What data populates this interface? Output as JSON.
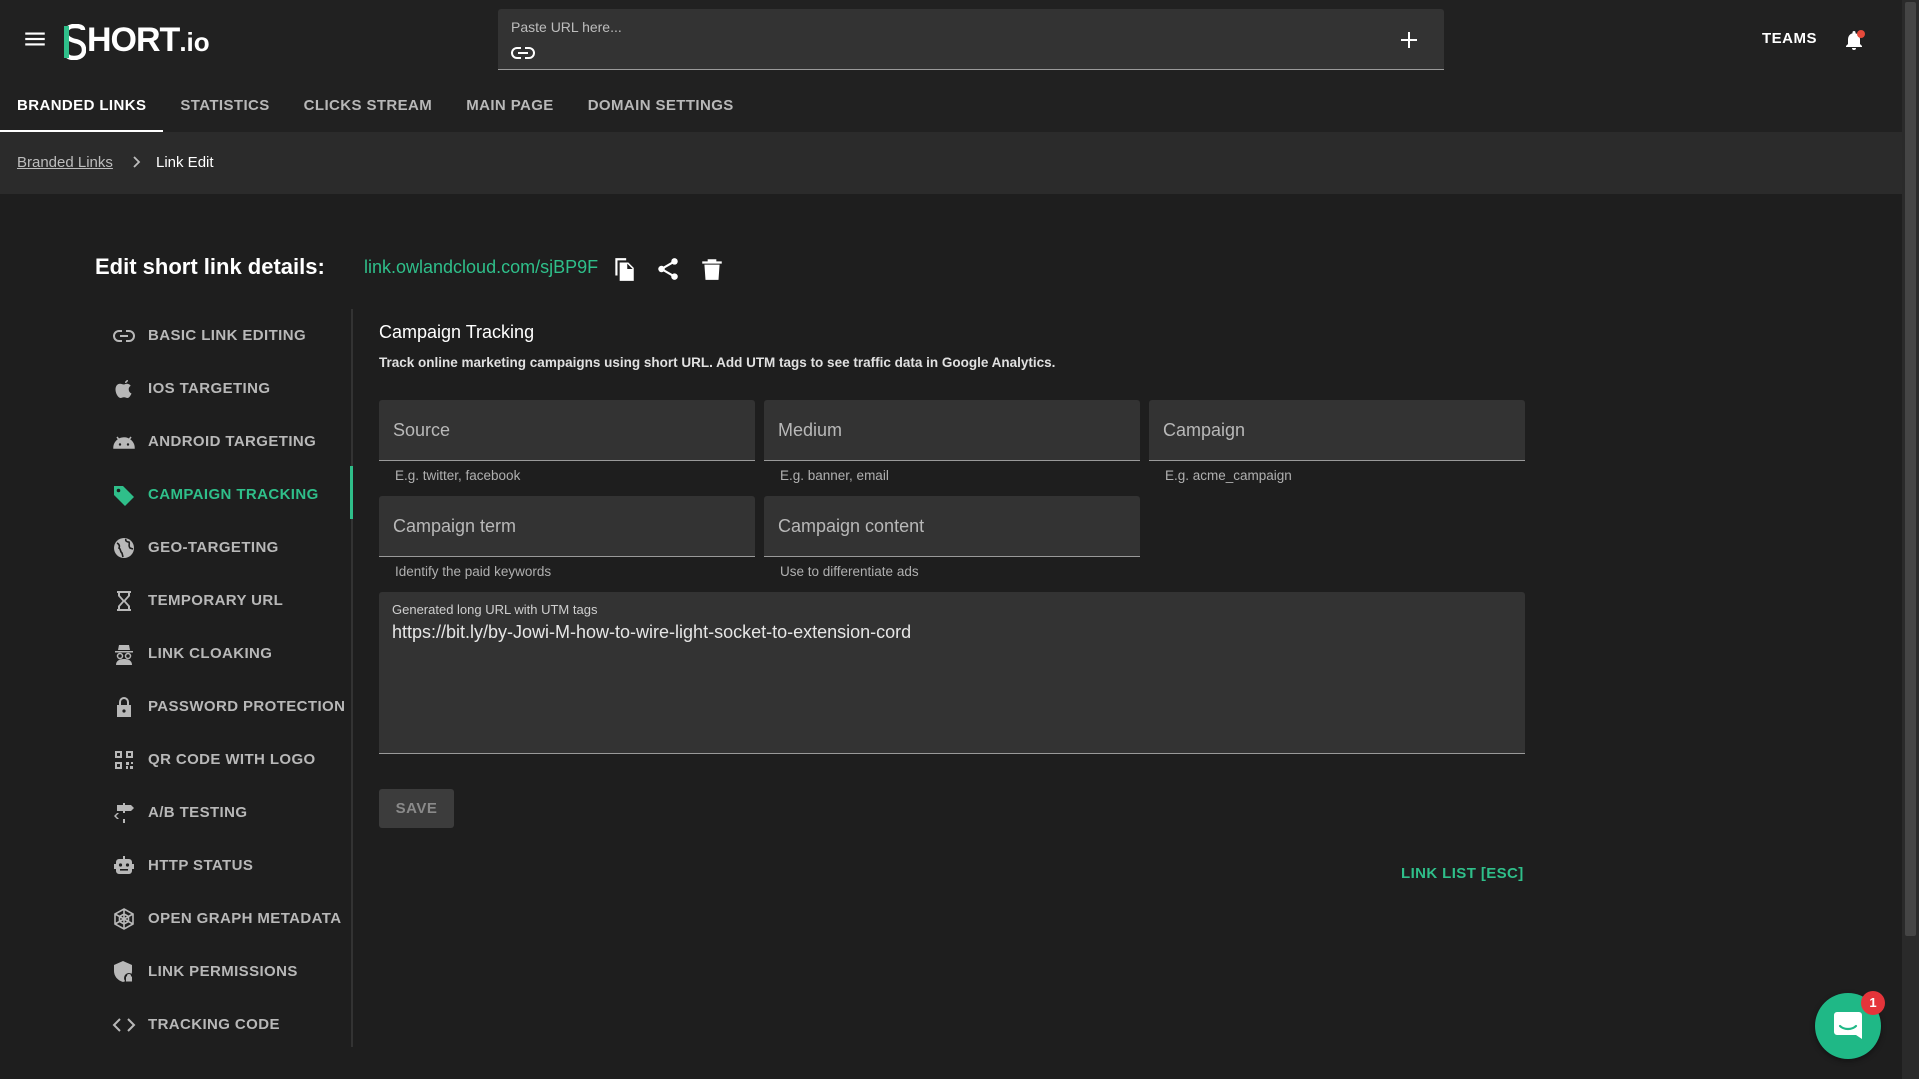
{
  "header": {
    "logo_main": "HORT",
    "logo_suffix": ".io",
    "url_placeholder": "Paste URL here...",
    "teams_label": "TEAMS"
  },
  "tabs": [
    {
      "label": "BRANDED LINKS",
      "active": true
    },
    {
      "label": "STATISTICS"
    },
    {
      "label": "CLICKS STREAM"
    },
    {
      "label": "MAIN PAGE"
    },
    {
      "label": "DOMAIN SETTINGS"
    }
  ],
  "breadcrumb": {
    "parent": "Branded Links",
    "current": "Link Edit"
  },
  "editor": {
    "title": "Edit short link details:",
    "short_link": "link.owlandcloud.com/sjBP9F"
  },
  "nav": [
    {
      "label": "BASIC LINK EDITING",
      "icon": "link-icon"
    },
    {
      "label": "IOS TARGETING",
      "icon": "apple-icon"
    },
    {
      "label": "ANDROID TARGETING",
      "icon": "android-icon"
    },
    {
      "label": "CAMPAIGN TRACKING",
      "icon": "tag-icon",
      "active": true
    },
    {
      "label": "GEO-TARGETING",
      "icon": "globe-icon"
    },
    {
      "label": "TEMPORARY URL",
      "icon": "hourglass-icon"
    },
    {
      "label": "LINK CLOAKING",
      "icon": "spy-icon"
    },
    {
      "label": "PASSWORD PROTECTION",
      "icon": "lock-icon"
    },
    {
      "label": "QR CODE WITH LOGO",
      "icon": "qr-code-icon"
    },
    {
      "label": "A/B TESTING",
      "icon": "signpost-icon"
    },
    {
      "label": "HTTP STATUS",
      "icon": "robot-icon"
    },
    {
      "label": "OPEN GRAPH METADATA",
      "icon": "graph-network-icon"
    },
    {
      "label": "LINK PERMISSIONS",
      "icon": "shield-lock-icon"
    },
    {
      "label": "TRACKING CODE",
      "icon": "code-icon"
    }
  ],
  "campaign": {
    "title": "Campaign Tracking",
    "description": "Track online marketing campaigns using short URL. Add UTM tags to see traffic data in Google Analytics.",
    "source": {
      "placeholder": "Source",
      "helper": "E.g. twitter, facebook",
      "value": ""
    },
    "medium": {
      "placeholder": "Medium",
      "helper": "E.g. banner, email",
      "value": ""
    },
    "campaign": {
      "placeholder": "Campaign",
      "helper": "E.g. acme_campaign",
      "value": ""
    },
    "term": {
      "placeholder": "Campaign term",
      "helper": "Identify the paid keywords",
      "value": ""
    },
    "content": {
      "placeholder": "Campaign content",
      "helper": "Use to differentiate ads",
      "value": ""
    },
    "long_url_label": "Generated long URL with UTM tags",
    "long_url": "https://bit.ly/by-Jowi-M-how-to-wire-light-socket-to-extension-cord",
    "save_label": "SAVE",
    "link_list_label": "LINK LIST [ESC]"
  },
  "chat": {
    "badge": "1"
  },
  "colors": {
    "accent": "#2fbf8a",
    "background": "#1e1e1e",
    "field": "#333333",
    "badge": "#e5343a"
  }
}
